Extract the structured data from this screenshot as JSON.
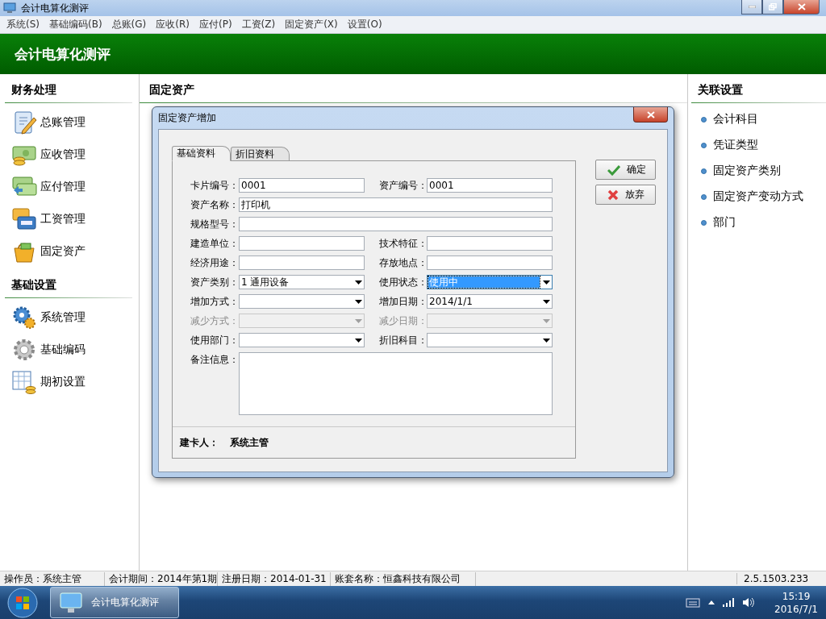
{
  "window": {
    "title": "会计电算化测评"
  },
  "menu": [
    {
      "label": "系统(S)"
    },
    {
      "label": "基础编码(B)"
    },
    {
      "label": "总账(G)"
    },
    {
      "label": "应收(R)"
    },
    {
      "label": "应付(P)"
    },
    {
      "label": "工资(Z)"
    },
    {
      "label": "固定资产(X)"
    },
    {
      "label": "设置(O)"
    }
  ],
  "banner": {
    "title": "会计电算化测评"
  },
  "sidebar": {
    "sections": [
      {
        "title": "财务处理",
        "items": [
          {
            "label": "总账管理"
          },
          {
            "label": "应收管理"
          },
          {
            "label": "应付管理"
          },
          {
            "label": "工资管理"
          },
          {
            "label": "固定资产"
          }
        ]
      },
      {
        "title": "基础设置",
        "items": [
          {
            "label": "系统管理"
          },
          {
            "label": "基础编码"
          },
          {
            "label": "期初设置"
          }
        ]
      }
    ]
  },
  "main": {
    "title": "固定资产"
  },
  "dialog": {
    "title": "固定资产增加",
    "tabs": [
      {
        "label": "基础资料",
        "selected": true
      },
      {
        "label": "折旧资料",
        "selected": false
      }
    ],
    "rows": [
      {
        "fields": [
          {
            "label": "卡片编号：",
            "kind": "text",
            "value": "0001",
            "disabled": false,
            "highlighted": false
          },
          {
            "label": "资产编号：",
            "kind": "text",
            "value": "0001",
            "disabled": false,
            "highlighted": false
          }
        ]
      },
      {
        "fields": [
          {
            "label": "资产名称：",
            "kind": "text",
            "value": "打印机",
            "disabled": false,
            "highlighted": false
          }
        ]
      },
      {
        "fields": [
          {
            "label": "规格型号：",
            "kind": "text",
            "disabled": false,
            "highlighted": false
          }
        ]
      },
      {
        "fields": [
          {
            "label": "建造单位：",
            "kind": "text",
            "disabled": false,
            "highlighted": false
          },
          {
            "label": "技术特征：",
            "kind": "text",
            "disabled": false,
            "highlighted": false
          }
        ]
      },
      {
        "fields": [
          {
            "label": "经济用途：",
            "kind": "text",
            "disabled": false,
            "highlighted": false
          },
          {
            "label": "存放地点：",
            "kind": "text",
            "disabled": false,
            "highlighted": false
          }
        ]
      },
      {
        "fields": [
          {
            "label": "资产类别：",
            "kind": "combo",
            "value": "1 通用设备",
            "disabled": false,
            "highlighted": false
          },
          {
            "label": "使用状态：",
            "kind": "combo",
            "value": "使用中",
            "disabled": false,
            "highlighted": true
          }
        ]
      },
      {
        "fields": [
          {
            "label": "增加方式：",
            "kind": "combo",
            "disabled": false,
            "highlighted": false
          },
          {
            "label": "增加日期：",
            "kind": "combo",
            "value": "2014/1/1",
            "disabled": false,
            "highlighted": false
          }
        ]
      },
      {
        "fields": [
          {
            "label": "减少方式：",
            "kind": "combo",
            "disabled": true,
            "highlighted": false
          },
          {
            "label": "减少日期：",
            "kind": "combo",
            "disabled": true,
            "highlighted": false
          }
        ]
      },
      {
        "fields": [
          {
            "label": "使用部门：",
            "kind": "combo",
            "disabled": false,
            "highlighted": false
          },
          {
            "label": "折旧科目：",
            "kind": "combo",
            "disabled": false,
            "highlighted": false
          }
        ]
      },
      {
        "fields": [
          {
            "label": "备注信息：",
            "kind": "textarea",
            "disabled": false,
            "highlighted": false
          }
        ]
      }
    ],
    "creator": {
      "label": "建卡人：",
      "value": "系统主管"
    },
    "buttons": [
      {
        "label": "确定",
        "kind": "ok"
      },
      {
        "label": "放弃",
        "kind": "cancel"
      }
    ]
  },
  "related": {
    "title": "关联设置",
    "items": [
      {
        "label": "会计科目"
      },
      {
        "label": "凭证类型"
      },
      {
        "label": "固定资产类别"
      },
      {
        "label": "固定资产变动方式"
      },
      {
        "label": "部门"
      }
    ]
  },
  "status_bar": {
    "segments": [
      {
        "text": "操作员：系统主管"
      },
      {
        "text": "会计期间：2014年第1期"
      },
      {
        "text": "注册日期：2014-01-31"
      },
      {
        "text": "账套名称：恒鑫科技有限公司"
      }
    ],
    "version": "2.5.1503.233"
  },
  "taskbar": {
    "task": "会计电算化测评",
    "time": "15:19",
    "date": "2016/7/1"
  }
}
